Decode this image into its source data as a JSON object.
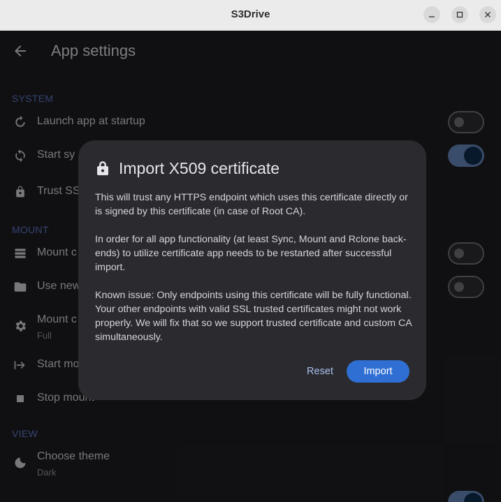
{
  "window": {
    "title": "S3Drive"
  },
  "header": {
    "title": "App settings"
  },
  "sections": {
    "system": {
      "label": "SYSTEM",
      "launch_at_startup": "Launch app at startup",
      "start_sync": "Start sy",
      "trust_ssl": "Trust SS"
    },
    "mount": {
      "label": "MOUNT",
      "mount_item": "Mount c",
      "use_new": "Use new",
      "mount_mode": "Mount c",
      "mount_mode_value": "Full",
      "start_mount": "Start mo",
      "stop_mount": "Stop mount"
    },
    "view": {
      "label": "VIEW",
      "choose_theme": "Choose theme",
      "theme_value": "Dark"
    }
  },
  "toggles": {
    "launch_at_startup": false,
    "start_sync": true,
    "mount_item": false,
    "use_new": false
  },
  "dialog": {
    "title": "Import X509 certificate",
    "paragraph1": "This will trust any HTTPS endpoint which uses this certificate directly or is signed by this certificate (in case of Root CA).",
    "paragraph2": "In order for all app functionality (at least Sync, Mount and Rclone back-ends) to utilize certificate app needs to be restarted after successful import.",
    "paragraph3": "Known issue: Only endpoints using this certificate will be fully functional. Your other endpoints with valid SSL trusted certificates might not work properly. We will fix that so we support trusted certificate and custom CA simultaneously.",
    "reset_label": "Reset",
    "import_label": "Import"
  },
  "colors": {
    "accent": "#2f6fd4",
    "section_label": "#5b6fbd",
    "toggle_on": "#5f7fb0"
  }
}
